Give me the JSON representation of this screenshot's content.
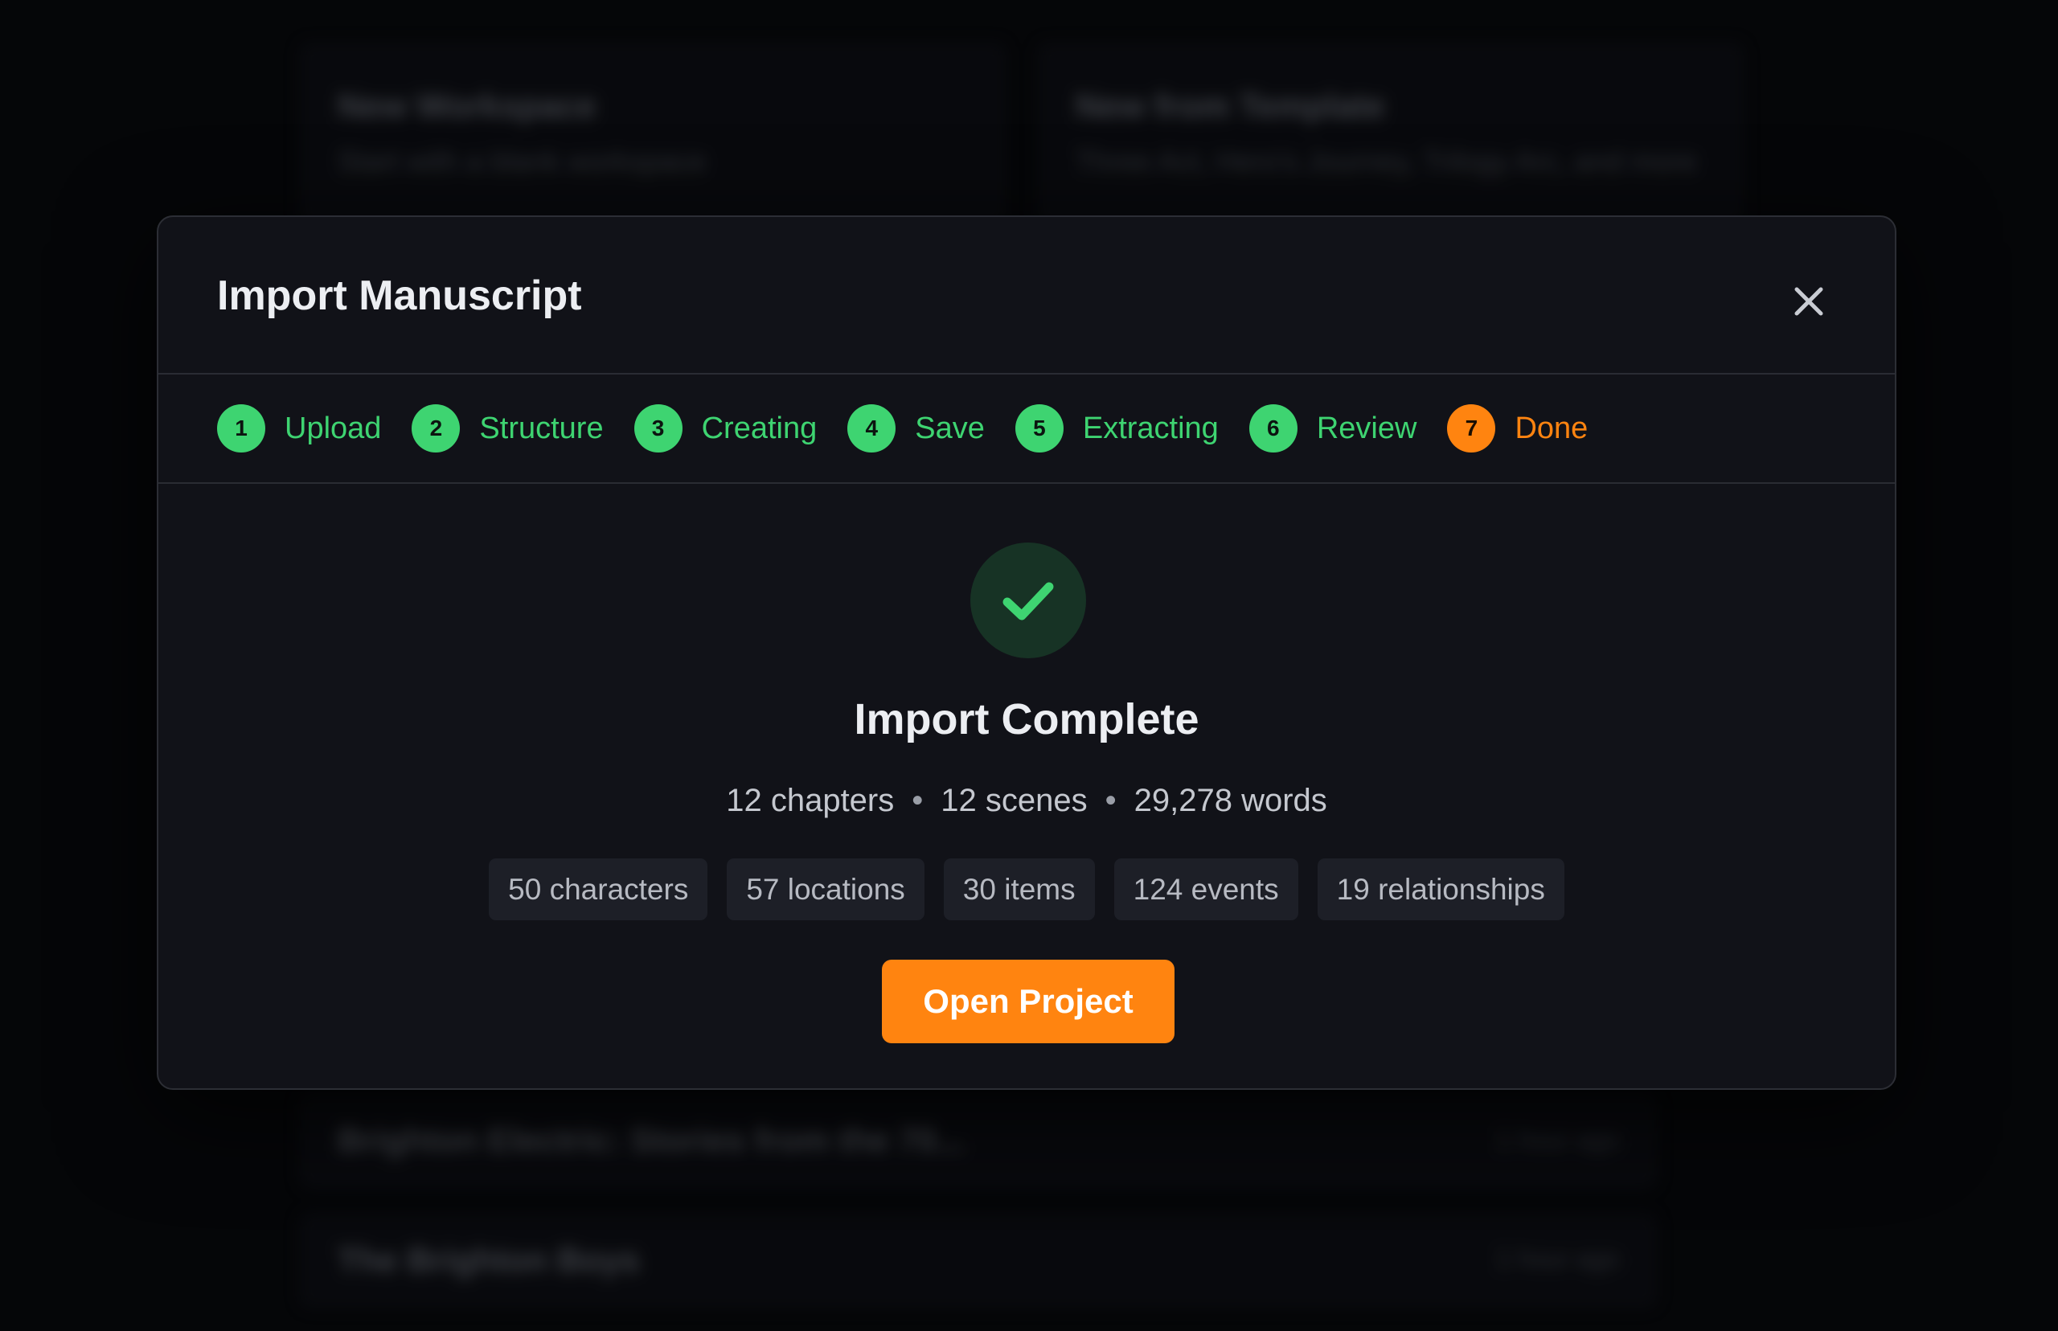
{
  "background": {
    "cards": [
      {
        "title": "New Workspace",
        "subtitle": "Start with a blank workspace"
      },
      {
        "title": "New from Template",
        "subtitle": "Three Act, Hero's Journey, Trilogy Arc, and more"
      }
    ],
    "projects": [
      {
        "title": "Brighton Electric: Stories from the 70...",
        "meta": "1 hour ago"
      },
      {
        "title": "The Brighton Boys",
        "meta": "1 hour ago"
      }
    ]
  },
  "modal": {
    "title": "Import Manuscript",
    "close_icon": "close-icon",
    "steps": [
      {
        "number": "1",
        "label": "Upload",
        "state": "complete"
      },
      {
        "number": "2",
        "label": "Structure",
        "state": "complete"
      },
      {
        "number": "3",
        "label": "Creating",
        "state": "complete"
      },
      {
        "number": "4",
        "label": "Save",
        "state": "complete"
      },
      {
        "number": "5",
        "label": "Extracting",
        "state": "complete"
      },
      {
        "number": "6",
        "label": "Review",
        "state": "complete"
      },
      {
        "number": "7",
        "label": "Done",
        "state": "active"
      }
    ],
    "result": {
      "icon": "check-icon",
      "title": "Import Complete",
      "chapters": "12 chapters",
      "scenes": "12 scenes",
      "words": "29,278 words",
      "separator": "•",
      "chips": [
        "50 characters",
        "57 locations",
        "30 items",
        "124 events",
        "19 relationships"
      ],
      "button_label": "Open Project"
    }
  },
  "colors": {
    "step_complete": "#3ed471",
    "step_active": "#ff8410",
    "primary_button": "#ff8410",
    "modal_background": "#111218"
  }
}
